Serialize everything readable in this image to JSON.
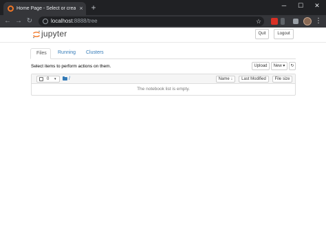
{
  "browser": {
    "tab_title": "Home Page - Select or create a n",
    "tab_close": "×",
    "new_tab": "+",
    "win_min": "─",
    "win_max": "☐",
    "win_close": "✕",
    "url_host": "localhost",
    "url_path": ":8888/tree",
    "star": "☆",
    "menu": "⋮"
  },
  "header": {
    "logo_text": "jupyter",
    "quit_label": "Quit",
    "logout_label": "Logout"
  },
  "tabs": [
    {
      "label": "Files"
    },
    {
      "label": "Running"
    },
    {
      "label": "Clusters"
    }
  ],
  "files": {
    "hint": "Select items to perform actions on them.",
    "upload_label": "Upload",
    "new_label": "New ▾",
    "refresh_icon": "↻",
    "selected_count": "0",
    "caret": "▾",
    "breadcrumb": "/",
    "sort_name_label": "Name ↓",
    "last_modified_label": "Last Modified",
    "file_size_label": "File size",
    "empty_message": "The notebook list is empty."
  },
  "colors": {
    "brand_orange": "#f37726",
    "link_blue": "#337ab7"
  }
}
